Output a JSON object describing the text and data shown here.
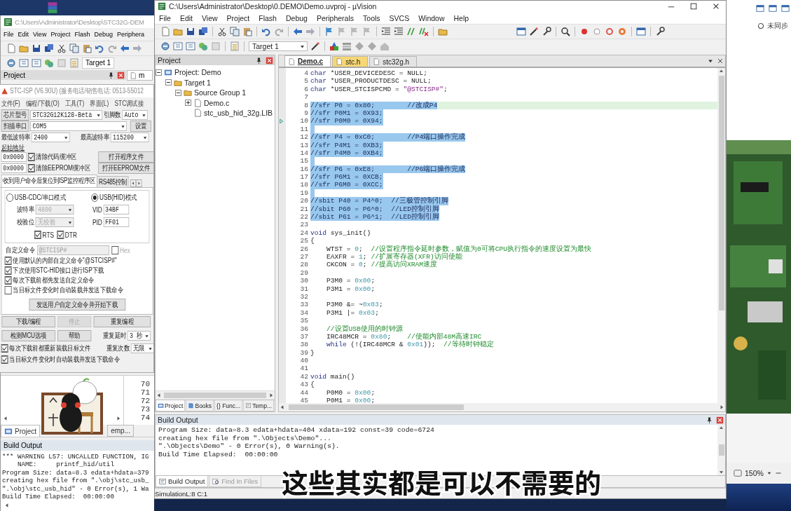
{
  "back_window": {
    "title": "C:\\Users\\Administrator\\Desktop\\STC32G-DEM",
    "menu": [
      "File",
      "Edit",
      "View",
      "Project",
      "Flash",
      "Debug",
      "Periphera"
    ],
    "target": "Target 1",
    "project_title": "Project",
    "editor_tab": "m",
    "line_numbers": [
      "70",
      "71",
      "72",
      "73",
      "74"
    ],
    "pane_tabs": [
      {
        "label": "Project",
        "selected": true
      },
      {
        "label": "emp...",
        "selected": false
      }
    ],
    "build_output": {
      "title": "Build Output",
      "lines": [
        "*** WARNING L57: UNCALLED FUNCTION, IG",
        "    NAME:     printf_hid/util",
        "Program Size: data=8.3 edata+hdata=379",
        "creating hex file from \".\\obj\\stc_usb_",
        "\".\\obj\\stc_usb_hid\" - 0 Error(s), 1 Wa",
        "Build Time Elapsed:  00:00:00"
      ]
    }
  },
  "isp": {
    "title": "STC-ISP (V6.90U) (服务电话/销售电话: 0513-55012",
    "menu": [
      "文件(F)",
      "编程/下载(O)",
      "工具(T)",
      "界面(L)",
      "STC调试接"
    ],
    "chip": {
      "button": "芯片型号",
      "value": "STC32G12K128-Beta",
      "pins_label": "引脚数",
      "pins": "Auto"
    },
    "port": {
      "button": "扫描串口",
      "value": "COM5",
      "settings": "设置"
    },
    "baud": {
      "min_label": "最低波特率",
      "min": "2400",
      "max_label": "最高波特率",
      "max": "115200"
    },
    "start_label": "起始地址",
    "address_rows": [
      {
        "address": "0x0000",
        "label": "清除代码缓冲区",
        "checked": true,
        "button": "打开程序文件"
      },
      {
        "address": "0x0000",
        "label": "清除EEPROM缓冲区",
        "checked": true,
        "button": "打开EEPROM文件"
      }
    ],
    "tabs": [
      {
        "label": "收到用户命令后复位到ISP监控程序区",
        "selected": true
      },
      {
        "label": "RS485控制",
        "selected": false
      }
    ],
    "modes": [
      {
        "label": "USB-CDC/串口模式",
        "selected": false
      },
      {
        "label": "USB(HID)模式",
        "selected": true
      }
    ],
    "serial": {
      "baud_label": "波特率",
      "baud": "4800",
      "parity_label": "校验位",
      "parity": "无校验",
      "disabled": true,
      "lines": [
        {
          "label": "RTS",
          "checked": true
        },
        {
          "label": "DTR",
          "checked": true
        }
      ]
    },
    "hid": {
      "vid_label": "VID",
      "vid": "34BF",
      "pid_label": "PID",
      "pid": "FF01"
    },
    "custom": {
      "label": "自定义命令",
      "value": "@STCISP#",
      "disabled": true,
      "hex_label": "Hex",
      "hex": false
    },
    "options": [
      {
        "label": "使用默认的内部自定义命令\"@STCISP#\"",
        "checked": true
      },
      {
        "label": "下次使用STC-HID接口进行ISP下载",
        "checked": true
      },
      {
        "label": "每次下载前都先发送自定义命令",
        "checked": true
      },
      {
        "label": "当目标文件变化时自动装载并发送下载命令",
        "checked": false
      }
    ],
    "send_button": "发送用户自定义命令并开始下载",
    "actions": [
      {
        "label": "下载/编程",
        "disabled": false
      },
      {
        "label": "停止",
        "disabled": true
      },
      {
        "label": "重复编程",
        "disabled": false
      },
      {
        "label": "检测MCU选项",
        "disabled": false
      },
      {
        "label": "帮助",
        "disabled": false
      }
    ],
    "repeat": {
      "delay_label": "重复延时",
      "delay": "3 秒",
      "count_label": "重复次数",
      "count": "无限"
    },
    "reload_options": [
      {
        "label": "每次下载前都重新装载目标文件",
        "checked": true
      },
      {
        "label": "当目标文件变化时自动装载并发送下载命令",
        "checked": true
      }
    ]
  },
  "uvision": {
    "title": "C:\\Users\\Administrator\\Desktop\\0.DEMO\\Demo.uvproj - µVision",
    "menu": [
      "File",
      "Edit",
      "View",
      "Project",
      "Flash",
      "Debug",
      "Peripherals",
      "Tools",
      "SVCS",
      "Window",
      "Help"
    ],
    "target": "Target 1",
    "project": {
      "title": "Project",
      "tree": [
        {
          "label": "Project: Demo",
          "expanded": true,
          "has_children": true,
          "children": [
            {
              "label": "Target 1",
              "expanded": true,
              "has_children": true,
              "children": [
                {
                  "label": "Source Group 1",
                  "expanded": true,
                  "has_children": true,
                  "children": [
                    {
                      "label": "Demo.c",
                      "expanded": false,
                      "has_children": true
                    },
                    {
                      "label": "stc_usb_hid_32g.LIB",
                      "has_children": false
                    }
                  ]
                }
              ]
            }
          ]
        }
      ],
      "tabs": [
        {
          "label": "Project",
          "selected": true
        },
        {
          "label": "Books",
          "selected": false
        },
        {
          "label": "{} Func...",
          "selected": false
        },
        {
          "label": "Temp...",
          "selected": false
        }
      ]
    },
    "editor": {
      "tabs": [
        {
          "label": "Demo.c",
          "selected": true,
          "color": "#ffffff"
        },
        {
          "label": "stc.h",
          "selected": false,
          "color": "#f7d774"
        },
        {
          "label": "stc32g.h",
          "selected": false,
          "color": "#e4e4e4"
        }
      ],
      "lines": [
        {
          "number": "4",
          "selected": false,
          "current": false,
          "marker": false,
          "segments": [
            {
              "kind": "kw",
              "text": "char"
            },
            {
              "kind": "plain",
              "text": " *USER_DEVICEDESC = NULL;"
            }
          ]
        },
        {
          "number": "5",
          "selected": false,
          "current": false,
          "marker": false,
          "segments": [
            {
              "kind": "kw",
              "text": "char"
            },
            {
              "kind": "plain",
              "text": " *USER_PRODUCTDESC = NULL;"
            }
          ]
        },
        {
          "number": "6",
          "selected": false,
          "current": false,
          "marker": false,
          "segments": [
            {
              "kind": "kw",
              "text": "char"
            },
            {
              "kind": "plain",
              "text": " *USER_STCISPCMD = "
            },
            {
              "kind": "str",
              "text": "\"@STCISP#\""
            },
            {
              "kind": "plain",
              "text": ";"
            }
          ]
        },
        {
          "number": "7",
          "selected": false,
          "current": false,
          "marker": false
        },
        {
          "number": "8",
          "selected": true,
          "current": true,
          "marker": false,
          "segments": [
            {
              "kind": "comment",
              "text": "//sfr P0 = 0x80;        //改成P4"
            }
          ]
        },
        {
          "number": "9",
          "selected": true,
          "current": false,
          "marker": false,
          "segments": [
            {
              "kind": "comment",
              "text": "//sfr P0M1 = 0X93;"
            }
          ]
        },
        {
          "number": "10",
          "selected": true,
          "current": false,
          "marker": true,
          "segments": [
            {
              "kind": "comment",
              "text": "//sfr P0M0 = 0X94;"
            }
          ]
        },
        {
          "number": "11",
          "selected": true,
          "current": false,
          "marker": false
        },
        {
          "number": "12",
          "selected": true,
          "current": false,
          "marker": false,
          "segments": [
            {
              "kind": "comment",
              "text": "//sfr P4 = 0xC0;        //P4端口操作完成"
            }
          ]
        },
        {
          "number": "13",
          "selected": true,
          "current": false,
          "marker": false,
          "segments": [
            {
              "kind": "comment",
              "text": "//sfr P4M1 = 0XB3;"
            }
          ]
        },
        {
          "number": "14",
          "selected": true,
          "current": false,
          "marker": false,
          "segments": [
            {
              "kind": "comment",
              "text": "//sfr P4M0 = 0XB4;"
            }
          ]
        },
        {
          "number": "15",
          "selected": true,
          "current": false,
          "marker": false
        },
        {
          "number": "16",
          "selected": true,
          "current": false,
          "marker": false,
          "segments": [
            {
              "kind": "comment",
              "text": "//sfr P6 = 0xE8;        //P6端口操作完成"
            }
          ]
        },
        {
          "number": "17",
          "selected": true,
          "current": false,
          "marker": false,
          "segments": [
            {
              "kind": "comment",
              "text": "//sfr P6M1 = 0XCB;"
            }
          ]
        },
        {
          "number": "18",
          "selected": true,
          "current": false,
          "marker": false,
          "segments": [
            {
              "kind": "comment",
              "text": "//sfr P6M0 = 0XCC;"
            }
          ]
        },
        {
          "number": "19",
          "selected": true,
          "current": false,
          "marker": false
        },
        {
          "number": "20",
          "selected": true,
          "current": false,
          "marker": false,
          "segments": [
            {
              "kind": "comment",
              "text": "//sbit P40 = P4^0;  //三极管控制引脚"
            }
          ]
        },
        {
          "number": "21",
          "selected": true,
          "current": false,
          "marker": false,
          "segments": [
            {
              "kind": "comment",
              "text": "//sbit P60 = P6^0;  //LED控制引脚"
            }
          ]
        },
        {
          "number": "22",
          "selected": true,
          "current": false,
          "marker": false,
          "segments": [
            {
              "kind": "comment",
              "text": "//sbit P61 = P6^1;  //LED控制引脚"
            }
          ]
        },
        {
          "number": "23",
          "selected": false,
          "current": false,
          "marker": false
        },
        {
          "number": "24",
          "selected": false,
          "current": false,
          "marker": false,
          "segments": [
            {
              "kind": "kw",
              "text": "void"
            },
            {
              "kind": "plain",
              "text": " sys_init()"
            }
          ]
        },
        {
          "number": "25",
          "selected": false,
          "current": false,
          "marker": false,
          "segments": [
            {
              "kind": "plain",
              "text": "{"
            }
          ]
        },
        {
          "number": "26",
          "selected": false,
          "current": false,
          "marker": false,
          "segments": [
            {
              "kind": "plain",
              "text": "    WTST = "
            },
            {
              "kind": "num",
              "text": "0"
            },
            {
              "kind": "plain",
              "text": ";  "
            },
            {
              "kind": "comment",
              "text": "//设置程序指令延时参数，赋值为0可将CPU执行指令的速度设置为最快"
            }
          ]
        },
        {
          "number": "27",
          "selected": false,
          "current": false,
          "marker": false,
          "segments": [
            {
              "kind": "plain",
              "text": "    EAXFR = "
            },
            {
              "kind": "num",
              "text": "1"
            },
            {
              "kind": "plain",
              "text": "; "
            },
            {
              "kind": "comment",
              "text": "//扩展寄存器(XFR)访问使能"
            }
          ]
        },
        {
          "number": "28",
          "selected": false,
          "current": false,
          "marker": false,
          "segments": [
            {
              "kind": "plain",
              "text": "    CKCON = "
            },
            {
              "kind": "num",
              "text": "0"
            },
            {
              "kind": "plain",
              "text": "; "
            },
            {
              "kind": "comment",
              "text": "//提高访问XRAM速度"
            }
          ]
        },
        {
          "number": "29",
          "selected": false,
          "current": false,
          "marker": false
        },
        {
          "number": "30",
          "selected": false,
          "current": false,
          "marker": false,
          "segments": [
            {
              "kind": "plain",
              "text": "    P3M0 = "
            },
            {
              "kind": "num",
              "text": "0x00"
            },
            {
              "kind": "plain",
              "text": ";"
            }
          ]
        },
        {
          "number": "31",
          "selected": false,
          "current": false,
          "marker": false,
          "segments": [
            {
              "kind": "plain",
              "text": "    P3M1 = "
            },
            {
              "kind": "num",
              "text": "0x00"
            },
            {
              "kind": "plain",
              "text": ";"
            }
          ]
        },
        {
          "number": "32",
          "selected": false,
          "current": false,
          "marker": false
        },
        {
          "number": "33",
          "selected": false,
          "current": false,
          "marker": false,
          "segments": [
            {
              "kind": "plain",
              "text": "    P3M0 &= ~"
            },
            {
              "kind": "num",
              "text": "0x03"
            },
            {
              "kind": "plain",
              "text": ";"
            }
          ]
        },
        {
          "number": "34",
          "selected": false,
          "current": false,
          "marker": false,
          "segments": [
            {
              "kind": "plain",
              "text": "    P3M1 |= "
            },
            {
              "kind": "num",
              "text": "0x03"
            },
            {
              "kind": "plain",
              "text": ";"
            }
          ]
        },
        {
          "number": "35",
          "selected": false,
          "current": false,
          "marker": false
        },
        {
          "number": "36",
          "selected": false,
          "current": false,
          "marker": false,
          "segments": [
            {
              "kind": "comment",
              "text": "    //设置USB使用的时钟源"
            }
          ]
        },
        {
          "number": "37",
          "selected": false,
          "current": false,
          "marker": false,
          "segments": [
            {
              "kind": "plain",
              "text": "    IRC48MCR = "
            },
            {
              "kind": "num",
              "text": "0x80"
            },
            {
              "kind": "plain",
              "text": ";    "
            },
            {
              "kind": "comment",
              "text": "//使能内部48M高速IRC"
            }
          ]
        },
        {
          "number": "38",
          "selected": false,
          "current": false,
          "marker": false,
          "segments": [
            {
              "kind": "kw",
              "text": "    while"
            },
            {
              "kind": "plain",
              "text": " (!(IRC48MCR & "
            },
            {
              "kind": "num",
              "text": "0x01"
            },
            {
              "kind": "plain",
              "text": "));  "
            },
            {
              "kind": "comment",
              "text": "//等待时钟稳定"
            }
          ]
        },
        {
          "number": "39",
          "selected": false,
          "current": false,
          "marker": false,
          "segments": [
            {
              "kind": "plain",
              "text": "}"
            }
          ]
        },
        {
          "number": "40",
          "selected": false,
          "current": false,
          "marker": false
        },
        {
          "number": "41",
          "selected": false,
          "current": false,
          "marker": false
        },
        {
          "number": "42",
          "selected": false,
          "current": false,
          "marker": false,
          "segments": [
            {
              "kind": "kw",
              "text": "void"
            },
            {
              "kind": "plain",
              "text": " main()"
            }
          ]
        },
        {
          "number": "43",
          "selected": false,
          "current": false,
          "marker": false,
          "segments": [
            {
              "kind": "plain",
              "text": "{"
            }
          ]
        },
        {
          "number": "44",
          "selected": false,
          "current": false,
          "marker": false,
          "segments": [
            {
              "kind": "plain",
              "text": "    P0M0 = "
            },
            {
              "kind": "num",
              "text": "0x00"
            },
            {
              "kind": "plain",
              "text": ";"
            }
          ]
        },
        {
          "number": "45",
          "selected": false,
          "current": false,
          "marker": false,
          "segments": [
            {
              "kind": "plain",
              "text": "    P0M1 = "
            },
            {
              "kind": "num",
              "text": "0x00"
            },
            {
              "kind": "plain",
              "text": ";"
            }
          ]
        }
      ]
    },
    "build_output": {
      "title": "Build Output",
      "lines": [
        "Program Size: data=8.3 edata+hdata=404 xdata=192 const=39 code=6724",
        "creating hex file from \".\\Objects\\Demo\"...",
        "\".\\Objects\\Demo\" - 0 Error(s), 0 Warning(s).",
        "Build Time Elapsed:  00:00:00"
      ],
      "tabs": [
        {
          "label": "Build Output",
          "selected": true
        },
        {
          "label": "Find In Files",
          "selected": false
        }
      ]
    },
    "status_bar": {
      "mode": "Simulation",
      "position": "L:8 C:1"
    }
  },
  "side_panel": {
    "sync_status": "未同步",
    "zoom": "150%"
  },
  "subtitle": "这些其实都是可以不需要的"
}
